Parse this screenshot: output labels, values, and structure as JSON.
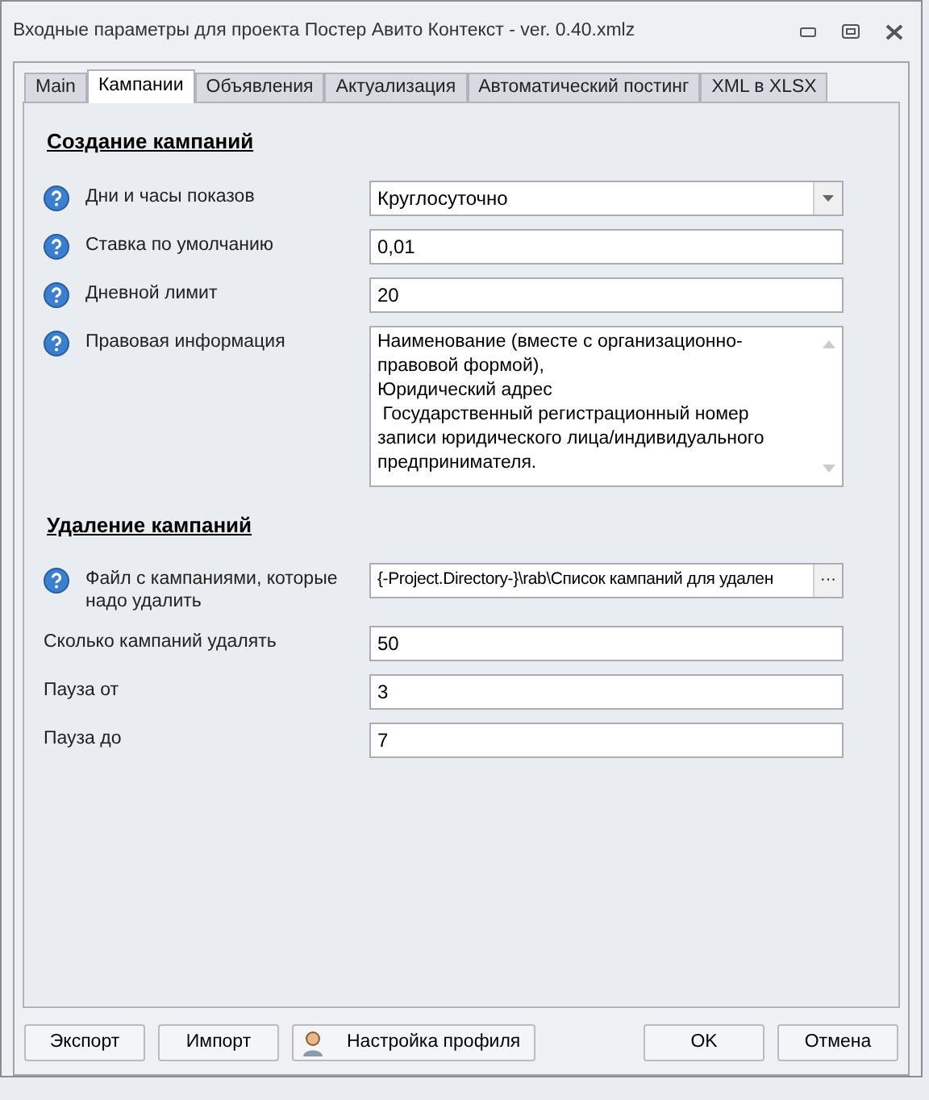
{
  "window": {
    "title": "Входные параметры для проекта Постер Авито Контекст - ver. 0.40.xmlz"
  },
  "tabs": [
    {
      "label": "Main",
      "selected": false
    },
    {
      "label": "Кампании",
      "selected": true
    },
    {
      "label": "Объявления",
      "selected": false
    },
    {
      "label": "Актуализация",
      "selected": false
    },
    {
      "label": "Автоматический постинг",
      "selected": false
    },
    {
      "label": "XML в XLSX",
      "selected": false
    }
  ],
  "sections": [
    {
      "title": "Создание кампаний",
      "rows": [
        {
          "kind": "select",
          "help": true,
          "label": "Дни и часы показов",
          "value": "Круглосуточно"
        },
        {
          "kind": "text",
          "help": true,
          "label": "Ставка по умолчанию",
          "value": "0,01"
        },
        {
          "kind": "text",
          "help": true,
          "label": "Дневной лимит",
          "value": "20"
        },
        {
          "kind": "textarea",
          "help": true,
          "label": "Правовая информация",
          "value": "Наименование (вместе с организационно-правовой формой),\nЮридический адрес\n Государственный регистрационный номер записи юридического лица/индивидуального предпринимателя."
        }
      ]
    },
    {
      "title": "Удаление кампаний",
      "rows": [
        {
          "kind": "file",
          "help": true,
          "label": "Файл с кампаниями, которые надо удалить",
          "value": "{-Project.Directory-}\\rab\\Список кампаний для удален",
          "button": "···"
        },
        {
          "kind": "text",
          "help": false,
          "label": "Сколько кампаний удалять",
          "value": "50"
        },
        {
          "kind": "text",
          "help": false,
          "label": "Пауза от",
          "value": "3"
        },
        {
          "kind": "text",
          "help": false,
          "label": "Пауза до",
          "value": "7"
        }
      ]
    }
  ],
  "buttons_left": [
    {
      "label": "Экспорт",
      "icon": false
    },
    {
      "label": "Импорт",
      "icon": false
    },
    {
      "label": "Настройка профиля",
      "icon": true
    }
  ],
  "buttons_right": [
    {
      "label": "OK"
    },
    {
      "label": "Отмена"
    }
  ]
}
